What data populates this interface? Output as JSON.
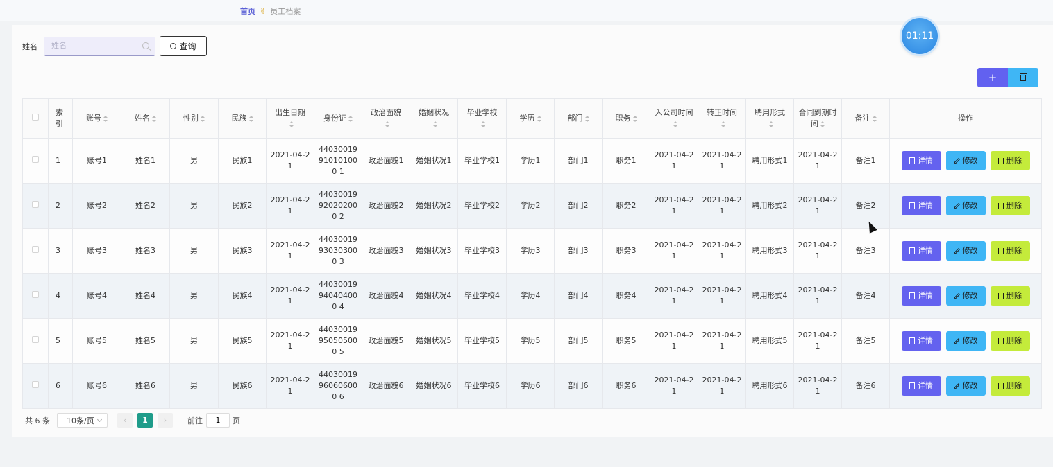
{
  "breadcrumb": {
    "home": "首页",
    "sep": "✌",
    "current": "员工档案"
  },
  "search": {
    "label": "姓名",
    "placeholder": "姓名",
    "query_label": "查询"
  },
  "timer": "01:11",
  "toolbar": {
    "add_label": "+"
  },
  "table": {
    "headers": [
      "索引",
      "账号",
      "姓名",
      "性别",
      "民族",
      "出生日期",
      "身份证",
      "政治面貌",
      "婚姻状况",
      "毕业学校",
      "学历",
      "部门",
      "职务",
      "入公司时间",
      "转正时间",
      "聘用形式",
      "合同到期时间",
      "备注",
      "操作"
    ],
    "rows": [
      {
        "index": "1",
        "account": "账号1",
        "name": "姓名1",
        "gender": "男",
        "ethnic": "民族1",
        "birth": "2021-04-21",
        "idcard": "44030019910101000 1",
        "politics": "政治面貌1",
        "marital": "婚姻状况1",
        "school": "毕业学校1",
        "edu": "学历1",
        "dept": "部门1",
        "post": "职务1",
        "join": "2021-04-21",
        "regular": "2021-04-21",
        "hire": "聘用形式1",
        "contract": "2021-04-21",
        "remark": "备注1"
      },
      {
        "index": "2",
        "account": "账号2",
        "name": "姓名2",
        "gender": "男",
        "ethnic": "民族2",
        "birth": "2021-04-21",
        "idcard": "44030019920202000 2",
        "politics": "政治面貌2",
        "marital": "婚姻状况2",
        "school": "毕业学校2",
        "edu": "学历2",
        "dept": "部门2",
        "post": "职务2",
        "join": "2021-04-21",
        "regular": "2021-04-21",
        "hire": "聘用形式2",
        "contract": "2021-04-21",
        "remark": "备注2"
      },
      {
        "index": "3",
        "account": "账号3",
        "name": "姓名3",
        "gender": "男",
        "ethnic": "民族3",
        "birth": "2021-04-21",
        "idcard": "44030019930303000 3",
        "politics": "政治面貌3",
        "marital": "婚姻状况3",
        "school": "毕业学校3",
        "edu": "学历3",
        "dept": "部门3",
        "post": "职务3",
        "join": "2021-04-21",
        "regular": "2021-04-21",
        "hire": "聘用形式3",
        "contract": "2021-04-21",
        "remark": "备注3"
      },
      {
        "index": "4",
        "account": "账号4",
        "name": "姓名4",
        "gender": "男",
        "ethnic": "民族4",
        "birth": "2021-04-21",
        "idcard": "44030019940404000 4",
        "politics": "政治面貌4",
        "marital": "婚姻状况4",
        "school": "毕业学校4",
        "edu": "学历4",
        "dept": "部门4",
        "post": "职务4",
        "join": "2021-04-21",
        "regular": "2021-04-21",
        "hire": "聘用形式4",
        "contract": "2021-04-21",
        "remark": "备注4"
      },
      {
        "index": "5",
        "account": "账号5",
        "name": "姓名5",
        "gender": "男",
        "ethnic": "民族5",
        "birth": "2021-04-21",
        "idcard": "44030019950505000 5",
        "politics": "政治面貌5",
        "marital": "婚姻状况5",
        "school": "毕业学校5",
        "edu": "学历5",
        "dept": "部门5",
        "post": "职务5",
        "join": "2021-04-21",
        "regular": "2021-04-21",
        "hire": "聘用形式5",
        "contract": "2021-04-21",
        "remark": "备注5"
      },
      {
        "index": "6",
        "account": "账号6",
        "name": "姓名6",
        "gender": "男",
        "ethnic": "民族6",
        "birth": "2021-04-21",
        "idcard": "44030019960606000 6",
        "politics": "政治面貌6",
        "marital": "婚姻状况6",
        "school": "毕业学校6",
        "edu": "学历6",
        "dept": "部门6",
        "post": "职务6",
        "join": "2021-04-21",
        "regular": "2021-04-21",
        "hire": "聘用形式6",
        "contract": "2021-04-21",
        "remark": "备注6"
      }
    ],
    "actions": {
      "detail": "详情",
      "edit": "修改",
      "delete": "删除"
    }
  },
  "pagination": {
    "total": "共 6 条",
    "page_size": "10条/页",
    "prev": "‹",
    "current": "1",
    "next": "›",
    "goto_prefix": "前往",
    "goto_value": "1",
    "goto_suffix": "页"
  },
  "colors": {
    "primary": "#6462ef",
    "info": "#3fb6f5",
    "warn": "#c4eb3b",
    "active_page": "#1f9c8a"
  }
}
